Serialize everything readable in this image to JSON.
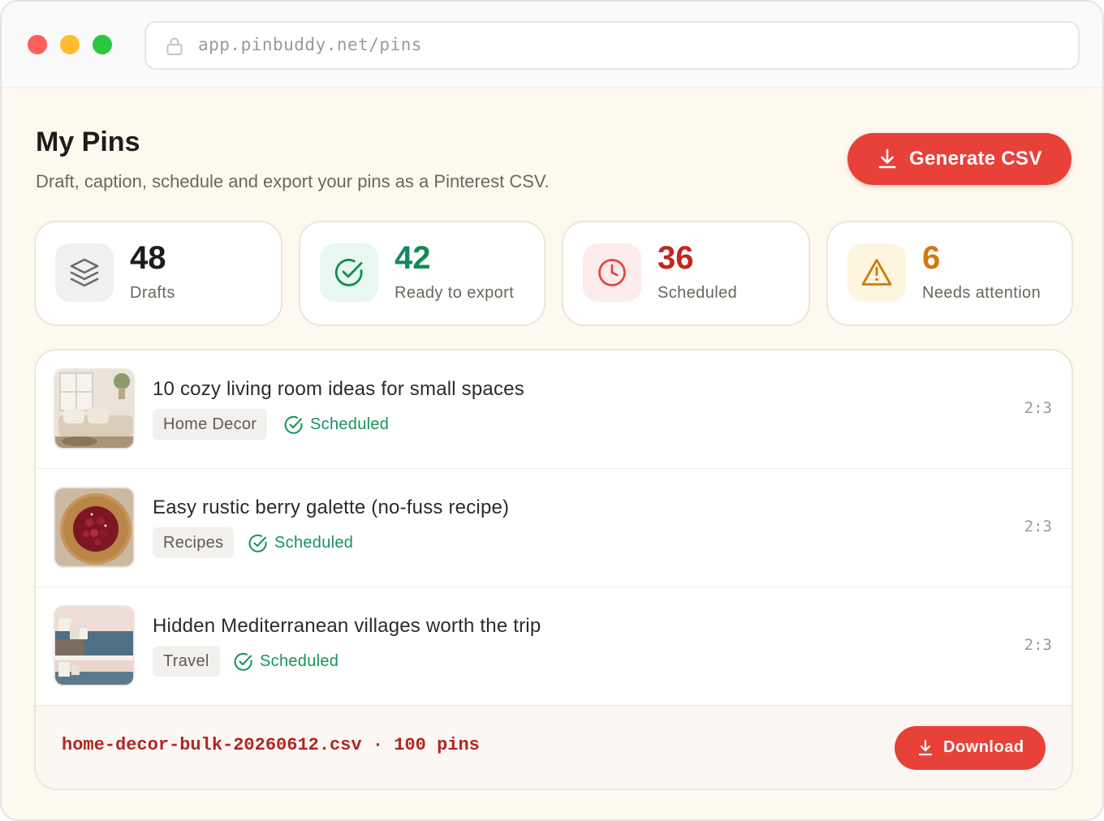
{
  "browser": {
    "url": "app.pinbuddy.net/pins"
  },
  "header": {
    "title": "My Pins",
    "subtitle": "Draft, caption, schedule and export your pins as a Pinterest CSV.",
    "generate_label": "Generate CSV"
  },
  "stats": [
    {
      "value": "48",
      "label": "Drafts",
      "icon": "layers-icon",
      "color": "#1c1c1c"
    },
    {
      "value": "42",
      "label": "Ready to export",
      "icon": "check-circle-icon",
      "color": "#128a5a"
    },
    {
      "value": "36",
      "label": "Scheduled",
      "icon": "clock-icon",
      "color": "#c0271f"
    },
    {
      "value": "6",
      "label": "Needs attention",
      "icon": "warning-icon",
      "color": "#d07a0c"
    }
  ],
  "pins": [
    {
      "title": "10 cozy living room ideas for small spaces",
      "category": "Home Decor",
      "status": "Scheduled",
      "ratio": "2:3",
      "thumb": "living-room-thumbnail"
    },
    {
      "title": "Easy rustic berry galette (no-fuss recipe)",
      "category": "Recipes",
      "status": "Scheduled",
      "ratio": "2:3",
      "thumb": "berry-galette-thumbnail"
    },
    {
      "title": "Hidden Mediterranean villages worth the trip",
      "category": "Travel",
      "status": "Scheduled",
      "ratio": "2:3",
      "thumb": "mediterranean-village-thumbnail"
    }
  ],
  "export": {
    "file": "home-decor-bulk-20260612.csv · 100 pins",
    "download_label": "Download"
  },
  "colors": {
    "accent": "#e8413a",
    "status_green": "#17935c",
    "page_bg": "#fdf9ef"
  }
}
